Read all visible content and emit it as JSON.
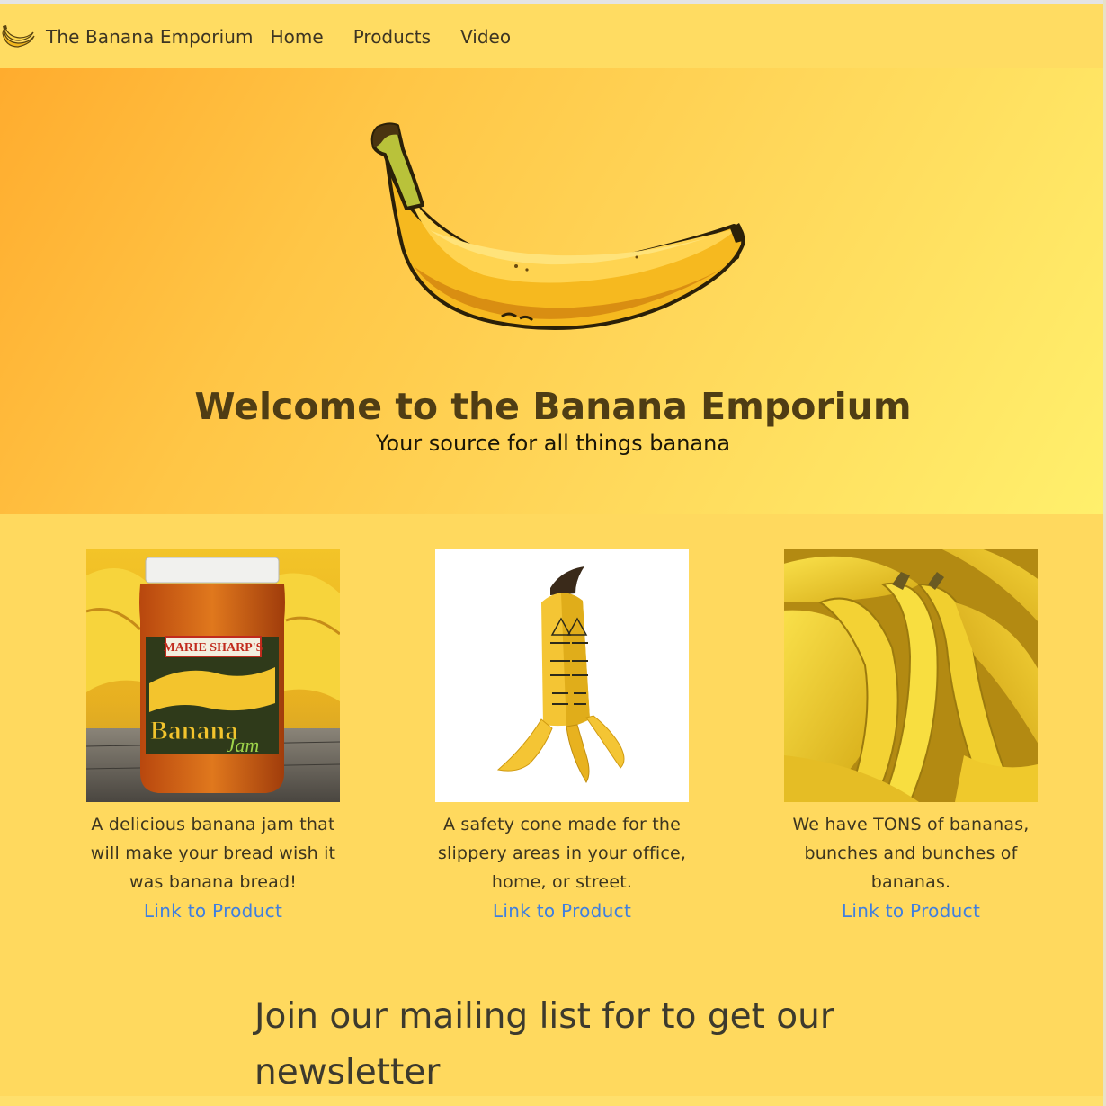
{
  "navbar": {
    "brand": "The Banana Emporium",
    "links": [
      "Home",
      "Products",
      "Video"
    ]
  },
  "hero": {
    "title": "Welcome to the Banana Emporium",
    "subtitle": "Your source for all things banana"
  },
  "products": [
    {
      "image_icon": "banana-jam-jar",
      "description": "A delicious banana jam that will make your bread wish it was banana bread!",
      "link": "Link to Product"
    },
    {
      "image_icon": "banana-safety-cone",
      "description": "A safety cone made for the slippery areas in your office, home, or street.",
      "link": "Link to Product"
    },
    {
      "image_icon": "banana-bunches",
      "description": "We have TONS of bananas, bunches and bunches of bananas.",
      "link": "Link to Product"
    }
  ],
  "jar_label": {
    "brand": "MARIE SHARP'S",
    "product_line1": "Banana",
    "product_line2": "Jam"
  },
  "newsletter": {
    "heading": "Join our mailing list for to get our newsletter"
  },
  "colors": {
    "navbar": "#ffdc62",
    "page": "#ffd95e",
    "link": "#3f7fe0",
    "title": "#4f3d14"
  }
}
